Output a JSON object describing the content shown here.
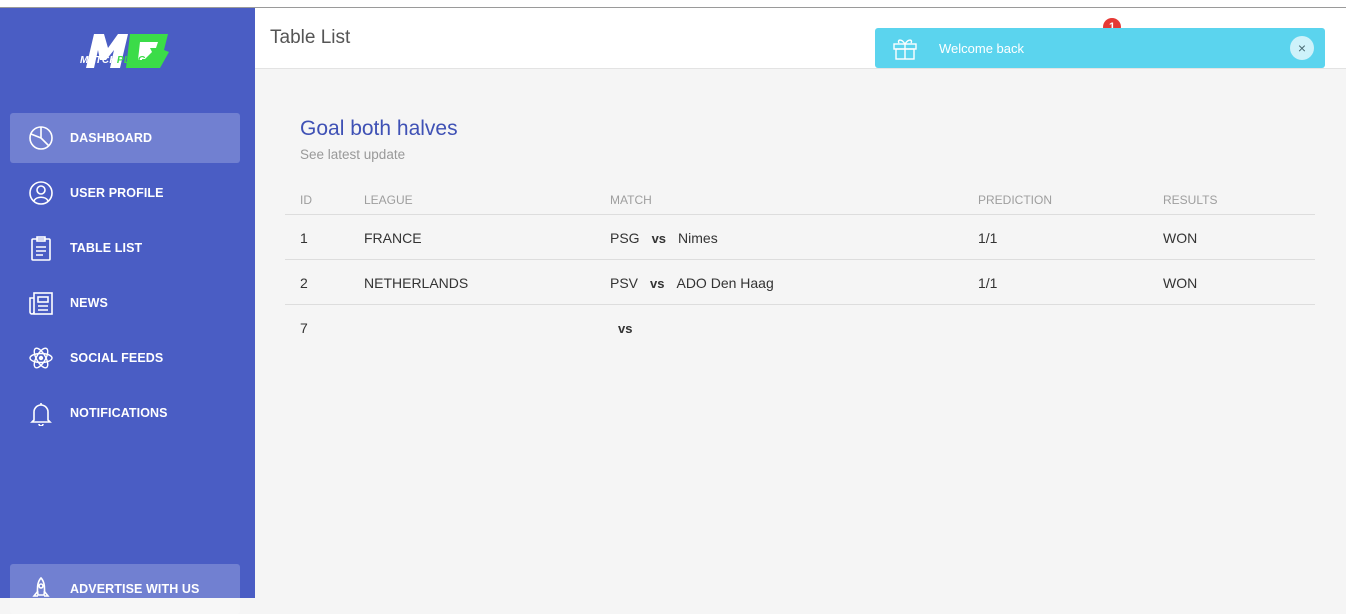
{
  "brand": {
    "logo_prefix": "MATCH",
    "logo_suffix": "PLUG"
  },
  "sidebar": {
    "items": [
      {
        "label": "DASHBOARD",
        "icon": "pie-chart-icon",
        "active": true
      },
      {
        "label": "USER PROFILE",
        "icon": "user-icon"
      },
      {
        "label": "TABLE LIST",
        "icon": "clipboard-icon"
      },
      {
        "label": "NEWS",
        "icon": "newspaper-icon"
      },
      {
        "label": "SOCIAL FEEDS",
        "icon": "atom-icon"
      },
      {
        "label": "NOTIFICATIONS",
        "icon": "bell-icon"
      }
    ],
    "advertise": {
      "label": "ADVERTISE WITH US",
      "icon": "rocket-icon"
    }
  },
  "header": {
    "title": "Table List",
    "notification_count": "1"
  },
  "toast": {
    "message": "Welcome back",
    "close": "×",
    "icon": "gift-icon"
  },
  "card": {
    "title": "Goal both halves",
    "subtitle": "See latest update",
    "columns": [
      "ID",
      "LEAGUE",
      "MATCH",
      "PREDICTION",
      "RESULTS"
    ],
    "rows": [
      {
        "id": "1",
        "league": "FRANCE",
        "home": "PSG",
        "vs": "vs",
        "away": "Nimes",
        "prediction": "1/1",
        "result": "WON"
      },
      {
        "id": "2",
        "league": "NETHERLANDS",
        "home": "PSV",
        "vs": "vs",
        "away": "ADO Den Haag",
        "prediction": "1/1",
        "result": "WON"
      },
      {
        "id": "7",
        "league": "",
        "home": "",
        "vs": "vs",
        "away": "",
        "prediction": "",
        "result": ""
      }
    ]
  }
}
